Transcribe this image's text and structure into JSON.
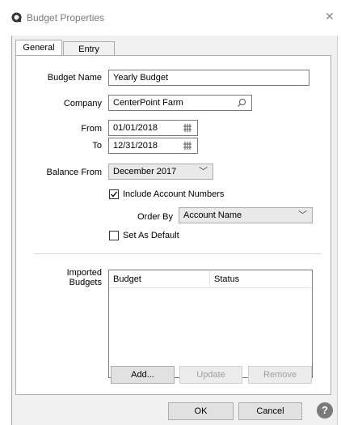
{
  "window": {
    "title": "Budget Properties"
  },
  "tabs": [
    {
      "label": "General"
    },
    {
      "label": "Entry Mode"
    }
  ],
  "form": {
    "budget_name": {
      "label": "Budget Name",
      "value": "Yearly Budget"
    },
    "company": {
      "label": "Company",
      "value": "CenterPoint Farm"
    },
    "from": {
      "label": "From",
      "value": "01/01/2018"
    },
    "to": {
      "label": "To",
      "value": "12/31/2018"
    },
    "balance_from": {
      "label": "Balance From",
      "value": "December 2017"
    },
    "include_account_numbers": {
      "label": "Include Account Numbers",
      "checked": true
    },
    "order_by": {
      "label": "Order By",
      "value": "Account Name"
    },
    "set_as_default": {
      "label": "Set As Default",
      "checked": false
    }
  },
  "imported_budgets": {
    "label_line1": "Imported",
    "label_line2": "Budgets",
    "columns": [
      "Budget",
      "Status"
    ],
    "rows": []
  },
  "list_buttons": {
    "add": "Add...",
    "update": "Update",
    "remove": "Remove"
  },
  "footer": {
    "ok": "OK",
    "cancel": "Cancel",
    "help_glyph": "?"
  },
  "icons": {
    "title": "app-logo-icon",
    "search": "search-icon",
    "calendar": "calendar-icon",
    "chevron": "chevron-down-icon"
  }
}
